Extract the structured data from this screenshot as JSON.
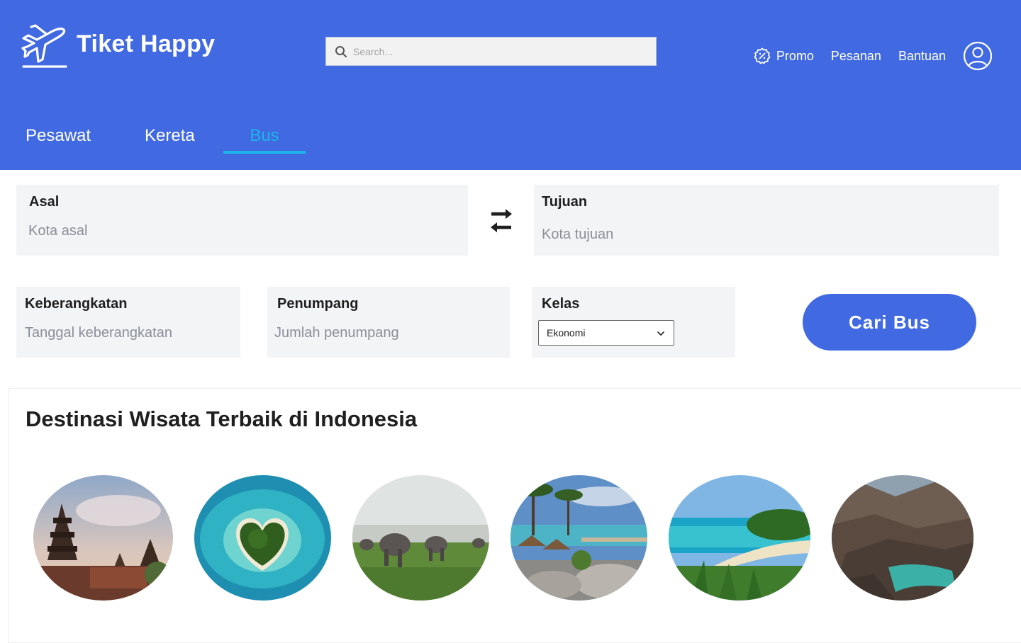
{
  "brand": {
    "name": "Tiket Happy"
  },
  "search": {
    "placeholder": "Search..."
  },
  "nav": {
    "promo": "Promo",
    "orders": "Pesanan",
    "help": "Bantuan"
  },
  "tabs": [
    {
      "label": "Pesawat",
      "active": false
    },
    {
      "label": "Kereta",
      "active": false
    },
    {
      "label": "Bus",
      "active": true
    }
  ],
  "form": {
    "origin": {
      "label": "Asal",
      "placeholder": "Kota asal"
    },
    "destination": {
      "label": "Tujuan",
      "placeholder": "Kota tujuan"
    },
    "departure": {
      "label": "Keberangkatan",
      "placeholder": "Tanggal keberangkatan"
    },
    "passengers": {
      "label": "Penumpang",
      "placeholder": "Jumlah penumpang"
    },
    "class": {
      "label": "Kelas",
      "selected": "Ekonomi"
    },
    "submit": "Cari  Bus"
  },
  "destinations": {
    "title": "Destinasi Wisata Terbaik di Indonesia",
    "items": [
      {
        "icon": "bali-temple-photo"
      },
      {
        "icon": "heart-island-photo"
      },
      {
        "icon": "elephants-savanna-photo"
      },
      {
        "icon": "beach-resort-photo"
      },
      {
        "icon": "tropical-beach-photo"
      },
      {
        "icon": "volcano-crater-lake-photo"
      }
    ]
  },
  "colors": {
    "primary": "#4169e1",
    "accent": "#1bb6e8",
    "field": "#f3f4f6"
  }
}
